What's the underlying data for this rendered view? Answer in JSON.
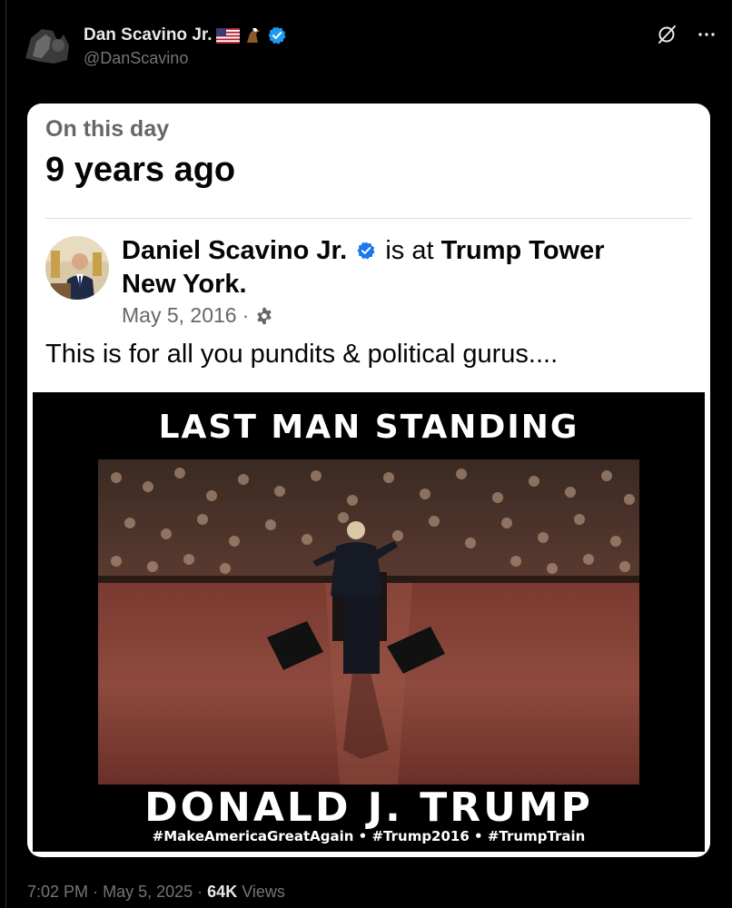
{
  "tweet": {
    "display_name": "Dan Scavino Jr.",
    "handle": "@DanScavino",
    "icons": [
      "flag-us-icon",
      "eagle-icon",
      "verified-icon",
      "grok-icon",
      "more-icon"
    ],
    "timestamp": "7:02 PM",
    "date": "May 5, 2025",
    "views_count": "64K",
    "views_label": "Views",
    "separator": "·"
  },
  "memory_card": {
    "label": "On this day",
    "years_ago": "9 years ago",
    "post": {
      "author": "Daniel Scavino Jr.",
      "is_at": "is at",
      "location": "Trump Tower New York.",
      "date": "May 5, 2016",
      "separator": "·",
      "text": "This is for all you pundits & political gurus....",
      "image": {
        "title": "LAST MAN STANDING",
        "name": "DONALD J. TRUMP",
        "hashtags": "#MakeAmericaGreatAgain • #Trump2016 • #TrumpTrain"
      }
    }
  },
  "colors": {
    "background": "#000000",
    "verified_blue": "#1d9bf0",
    "fb_verified_blue": "#1877f2",
    "muted_text": "#71767b"
  }
}
